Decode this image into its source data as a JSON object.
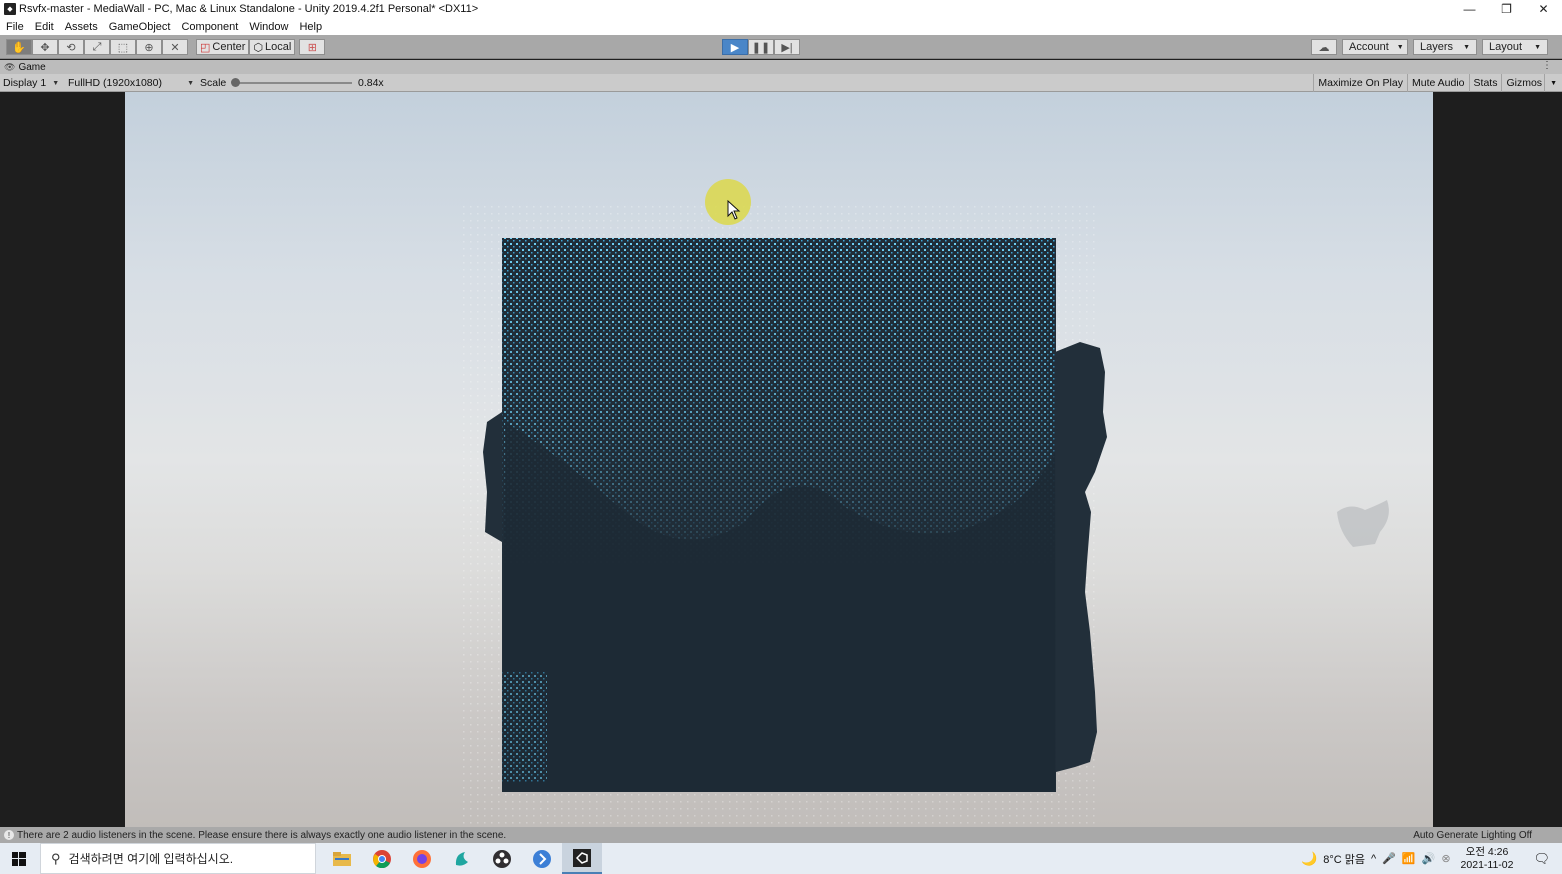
{
  "window": {
    "title": "Rsvfx-master - MediaWall - PC, Mac & Linux Standalone - Unity 2019.4.2f1 Personal* <DX11>",
    "controls": {
      "minimize": "—",
      "restore": "❐",
      "close": "✕"
    }
  },
  "menu": [
    "File",
    "Edit",
    "Assets",
    "GameObject",
    "Component",
    "Window",
    "Help"
  ],
  "toolbar": {
    "tools": [
      "hand-tool",
      "move-tool",
      "rotate-tool",
      "scale-tool",
      "rect-tool",
      "transform-tool",
      "custom-tool"
    ],
    "pivot_label": "Center",
    "space_label": "Local",
    "account_label": "Account",
    "layers_label": "Layers",
    "layout_label": "Layout"
  },
  "game_view": {
    "tab_label": "Game",
    "display": "Display 1",
    "resolution": "FullHD (1920x1080)",
    "scale_label": "Scale",
    "scale_value": "0.84x",
    "scale_fraction": 0.0,
    "maximize_on_play": "Maximize On Play",
    "mute_audio": "Mute Audio",
    "stats": "Stats",
    "gizmos": "Gizmos"
  },
  "status": {
    "message": "There are 2 audio listeners in the scene. Please ensure there is always exactly one audio listener in the scene.",
    "lighting": "Auto Generate Lighting Off"
  },
  "taskbar": {
    "search_placeholder": "검색하려면 여기에 입력하십시오.",
    "apps": [
      "file-explorer-icon",
      "chrome-icon",
      "firefox-icon",
      "app-icon",
      "obs-icon",
      "app-blue-icon",
      "unity-icon"
    ],
    "weather": "8°C  맑음",
    "time": "오전 4:26",
    "date": "2021-11-02"
  },
  "colors": {
    "play_accent": "#4a86c8",
    "point_cloud": "#5fc8f0",
    "depth_block": "#202d38",
    "cursor_highlight": "#dcd84a"
  }
}
